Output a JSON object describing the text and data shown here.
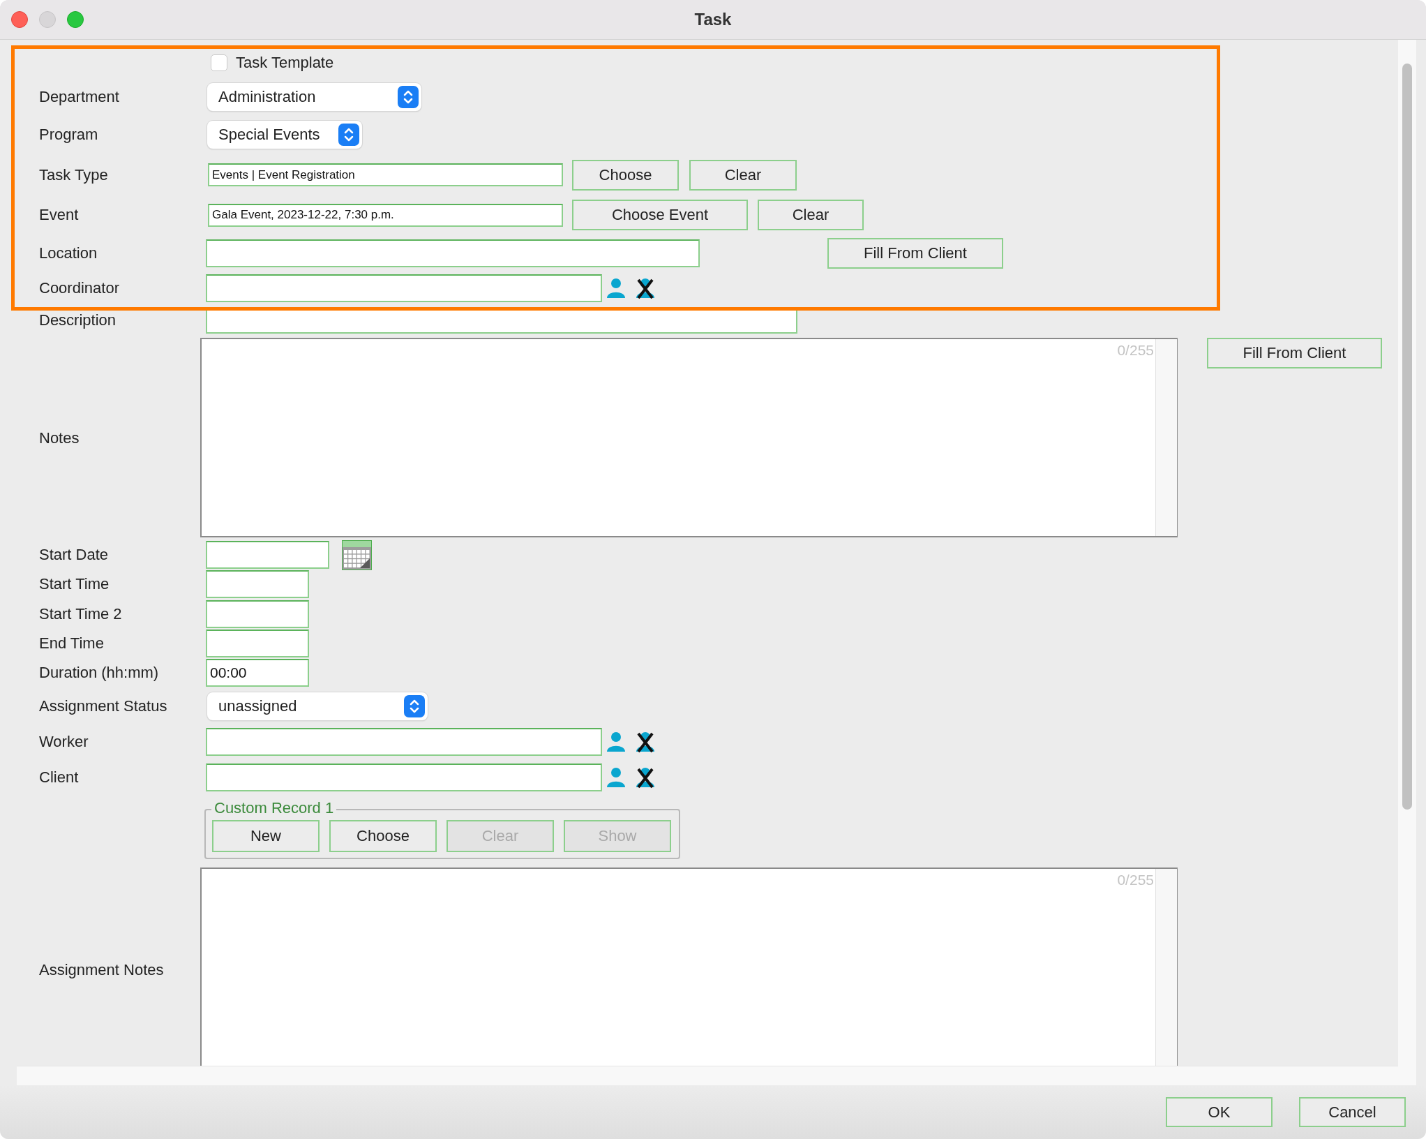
{
  "window": {
    "title": "Task"
  },
  "form": {
    "rows": [
      {
        "kind": "checkbox",
        "label": "Task Template",
        "checked": false
      },
      {
        "kind": "select",
        "label": "Department",
        "value": "Administration"
      },
      {
        "kind": "select",
        "label": "Program",
        "value": "Special Events"
      },
      {
        "kind": "text",
        "label": "Task Type",
        "value": "Events | Event Registration",
        "buttons": [
          {
            "label": "Choose",
            "disabled": false
          },
          {
            "label": "Clear",
            "disabled": false
          }
        ]
      },
      {
        "kind": "text",
        "label": "Event",
        "value": "Gala Event, 2023-12-22, 7:30 p.m.",
        "buttons": [
          {
            "label": "Choose Event",
            "disabled": false
          },
          {
            "label": "Clear",
            "disabled": false
          }
        ]
      },
      {
        "kind": "text",
        "label": "Location",
        "buttons": [
          {
            "label": "Fill From Client",
            "disabled": false
          }
        ]
      },
      {
        "kind": "person",
        "label": "Coordinator"
      },
      {
        "kind": "text",
        "label": "Description"
      },
      {
        "kind": "memo",
        "label": "Notes",
        "counter": "0/255",
        "buttons": [
          {
            "label": "Fill From Client",
            "disabled": false
          }
        ]
      },
      {
        "kind": "date",
        "label": "Start Date"
      },
      {
        "kind": "text",
        "label": "Start Time"
      },
      {
        "kind": "text",
        "label": "Start Time 2"
      },
      {
        "kind": "text",
        "label": "End Time"
      },
      {
        "kind": "text",
        "label": "Duration (hh:mm)",
        "value": "00:00"
      },
      {
        "kind": "select",
        "label": "Assignment Status",
        "value": "unassigned"
      },
      {
        "kind": "person",
        "label": "Worker"
      },
      {
        "kind": "person",
        "label": "Client"
      },
      {
        "kind": "group",
        "legend": "Custom Record 1",
        "buttons": [
          {
            "label": "New",
            "disabled": false
          },
          {
            "label": "Choose",
            "disabled": false
          },
          {
            "label": "Clear",
            "disabled": true
          },
          {
            "label": "Show",
            "disabled": true
          }
        ]
      },
      {
        "kind": "memo",
        "label": "Assignment Notes",
        "counter": "0/255"
      }
    ]
  },
  "footer": {
    "buttons": [
      {
        "label": "OK",
        "disabled": false
      },
      {
        "label": "Cancel",
        "disabled": false
      }
    ]
  }
}
